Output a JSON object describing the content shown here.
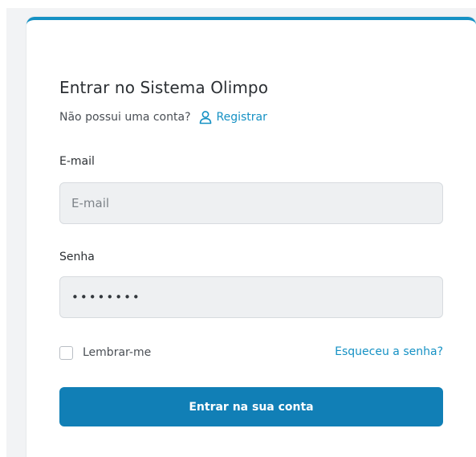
{
  "login": {
    "title": "Entrar no Sistema Olimpo",
    "no_account_text": "Não possui uma conta?",
    "register_icon": "user-icon",
    "register_link": "Registrar",
    "email": {
      "label": "E-mail",
      "placeholder": "E-mail",
      "value": ""
    },
    "password": {
      "label": "Senha",
      "value": "••••••••"
    },
    "remember_me": {
      "label": "Lembrar-me",
      "checked": false
    },
    "forgot_password": "Esqueceu a senha?",
    "submit_label": "Entrar na sua conta"
  },
  "colors": {
    "accent": "#1591c4",
    "button": "#117fb6",
    "input_bg": "#eef0f2",
    "page_bg": "#f2f3f5"
  }
}
